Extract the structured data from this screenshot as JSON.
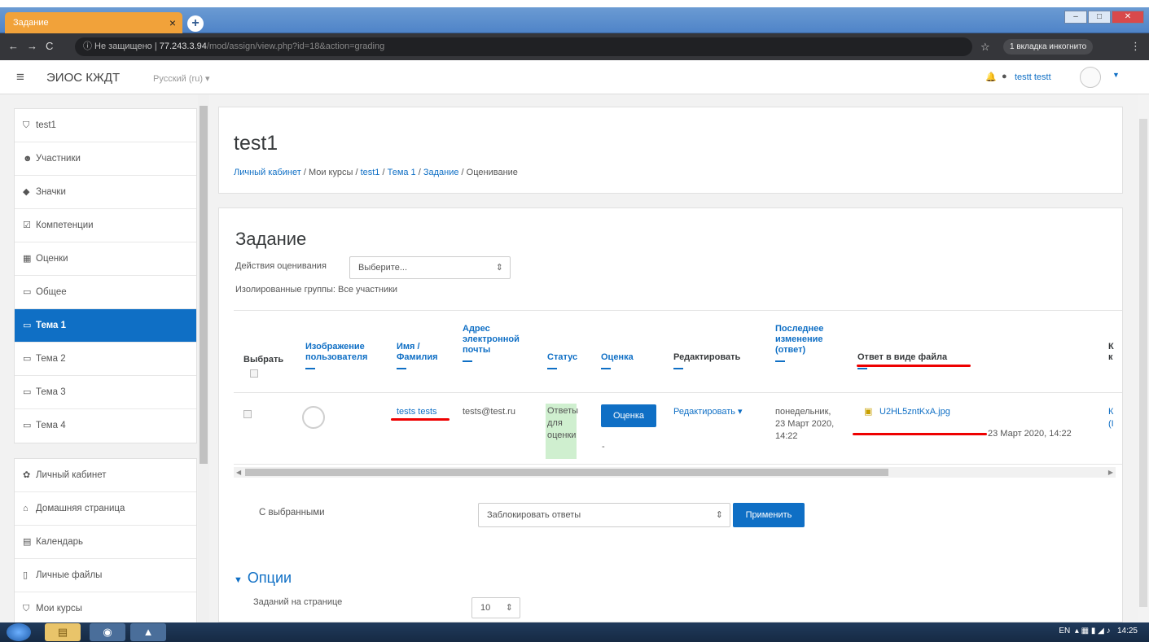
{
  "browser": {
    "tab_title": "Задание",
    "tab_close": "×",
    "new_tab": "+",
    "url_security": "ⓘ Не защищено",
    "url_host": "77.243.3.94",
    "url_path": "/mod/assign/view.php?id=18&action=grading",
    "incognito_label": "1 вкладка инкогнито"
  },
  "header": {
    "site_name": "ЭИОС КЖДТ",
    "language": "Русский (ru) ▾",
    "user_name": "testt testt"
  },
  "sidebar": {
    "items": [
      {
        "label": "test1",
        "icon": "graduation-cap-icon"
      },
      {
        "label": "Участники",
        "icon": "users-icon"
      },
      {
        "label": "Значки",
        "icon": "shield-icon"
      },
      {
        "label": "Компетенции",
        "icon": "checkbox-icon"
      },
      {
        "label": "Оценки",
        "icon": "table-icon"
      },
      {
        "label": "Общее",
        "icon": "folder-icon"
      },
      {
        "label": "Тема 1",
        "icon": "folder-icon",
        "active": true
      },
      {
        "label": "Тема 2",
        "icon": "folder-icon"
      },
      {
        "label": "Тема 3",
        "icon": "folder-icon"
      },
      {
        "label": "Тема 4",
        "icon": "folder-icon"
      }
    ],
    "items2": [
      {
        "label": "Личный кабинет",
        "icon": "dashboard-icon"
      },
      {
        "label": "Домашняя страница",
        "icon": "home-icon"
      },
      {
        "label": "Календарь",
        "icon": "calendar-icon"
      },
      {
        "label": "Личные файлы",
        "icon": "file-icon"
      },
      {
        "label": "Мои курсы",
        "icon": "graduation-cap-icon"
      }
    ]
  },
  "page": {
    "course_title": "test1",
    "breadcrumb": [
      "Личный кабинет",
      "Мои курсы",
      "test1",
      "Тема 1",
      "Задание",
      "Оценивание"
    ]
  },
  "assignment": {
    "heading": "Задание",
    "grading_actions_label": "Действия оценивания",
    "grading_actions_value": "Выберите...",
    "groups_label": "Изолированные группы: Все участники"
  },
  "table": {
    "headers": {
      "select": "Выбрать",
      "picture": "Изображение пользователя",
      "name": "Имя / Фамилия",
      "email": "Адрес электронной почты",
      "status": "Статус",
      "grade": "Оценка",
      "edit": "Редактировать",
      "modified": "Последнее изменение (ответ)",
      "file": "Ответ в виде файла",
      "cut": "К к"
    },
    "row": {
      "name": "tests tests",
      "email": "tests@test.ru",
      "status": "Ответы для оценки",
      "grade_button": "Оценка",
      "grade_value": "-",
      "edit_link": "Редактировать ▾",
      "modified": "понедельник, 23 Март 2020, 14:22",
      "file_name": "U2HL5zntKxA.jpg",
      "file_date": "23 Март 2020, 14:22",
      "cut_col": "К (I"
    }
  },
  "bulk": {
    "label": "С выбранными",
    "select_value": "Заблокировать ответы",
    "apply_button": "Применить"
  },
  "options": {
    "heading": "Опции",
    "per_page_label": "Заданий на странице",
    "per_page_value": "10"
  },
  "taskbar": {
    "lang": "EN",
    "time": "14:25"
  },
  "colors": {
    "accent": "#0f6fc5",
    "status_bg": "#cfefcf",
    "highlight": "#e00000"
  }
}
